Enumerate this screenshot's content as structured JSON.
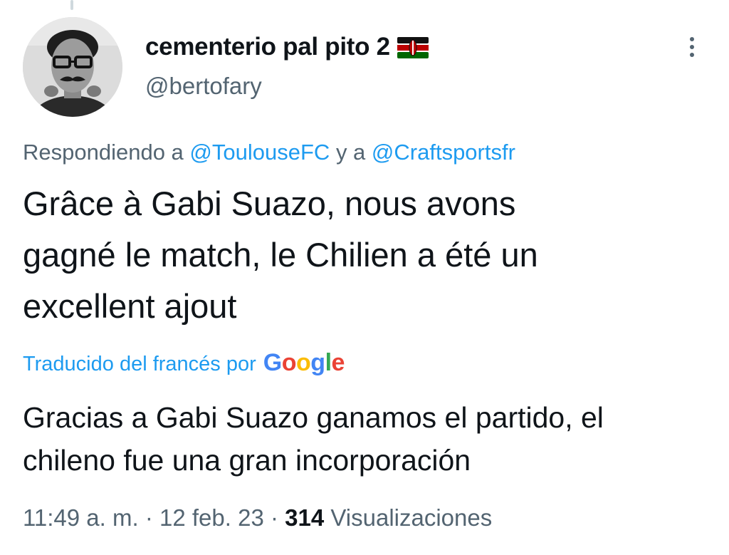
{
  "tweet": {
    "author": {
      "display_name": "cementerio pal pito 2",
      "flag_emoji": "kenya-flag",
      "handle": "@bertofary",
      "avatar": "profile-photo"
    },
    "more_menu_icon": "more-vertical-icon",
    "reply_context": {
      "prefix": "Respondiendo a",
      "mention_1": "@ToulouseFC",
      "joiner": "y a",
      "mention_2": "@Craftsportsfr"
    },
    "text_lines": [
      "Grâce à Gabi Suazo, nous avons",
      "gagné le match, le Chilien a été un",
      "excellent ajout"
    ],
    "translation_label": "Traducido del francés por",
    "translation_provider": "Google",
    "translation_lines": [
      "Gracias a Gabi Suazo ganamos el partido, el",
      "chileno fue una gran incorporación"
    ],
    "meta": {
      "time": "11:49 a. m.",
      "separator": "·",
      "date": "12 feb. 23",
      "views_count": "314",
      "views_label": "Visualizaciones"
    }
  },
  "colors": {
    "accent": "#1d9bf0",
    "secondary_text": "#536471",
    "primary_text": "#0f1419"
  }
}
